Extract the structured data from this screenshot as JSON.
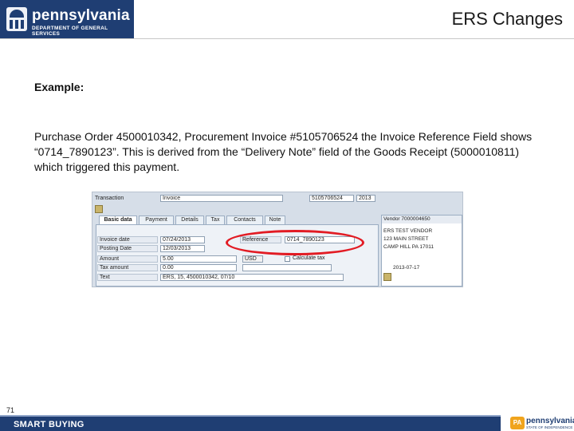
{
  "header": {
    "logo_name": "pennsylvania",
    "logo_sub": "DEPARTMENT OF GENERAL SERVICES",
    "slide_title": "ERS Changes"
  },
  "content": {
    "example_label": "Example:",
    "paragraph": "Purchase Order 4500010342, Procurement Invoice #5105706524 the Invoice Reference Field shows “0714_7890123”.  This is derived from the “Delivery Note” field of the Goods Receipt (5000010811) which triggered this payment."
  },
  "sap_screen": {
    "transaction_label": "Transaction",
    "transaction_value": "Invoice",
    "document_number": "5105706524",
    "fiscal_year": "2013",
    "tabs": [
      "Basic data",
      "Payment",
      "Details",
      "Tax",
      "Contacts",
      "Note"
    ],
    "fields": {
      "invoice_date_label": "Invoice date",
      "invoice_date_value": "07/24/2013",
      "posting_date_label": "Posting Date",
      "posting_date_value": "12/03/2013",
      "amount_label": "Amount",
      "amount_value": "5.00",
      "tax_amount_label": "Tax amount",
      "tax_amount_value": "0.00",
      "text_label": "Text",
      "text_value": "ERS, 15, 4500010342, 07/10",
      "reference_label": "Reference",
      "reference_value": "0714_7890123",
      "currency_value": "USD",
      "calculate_tax_label": "Calculate tax"
    },
    "vendor_panel": {
      "title": "Vendor 7000004650",
      "line1": "ERS TEST VENDOR",
      "line2": "123 MAIN STREET",
      "line3": "CAMP HILL PA 17011",
      "line4": "2013-07-17"
    }
  },
  "footer": {
    "page_number": "71",
    "program": "SMART BUYING",
    "pa_badge": "PA",
    "pa_word": "pennsylvania",
    "pa_sub": "STATE OF INDEPENDENCE"
  },
  "colors": {
    "brand_navy": "#1f3e73",
    "highlight_red": "#e21b23",
    "accent_gold": "#f0a41d"
  }
}
